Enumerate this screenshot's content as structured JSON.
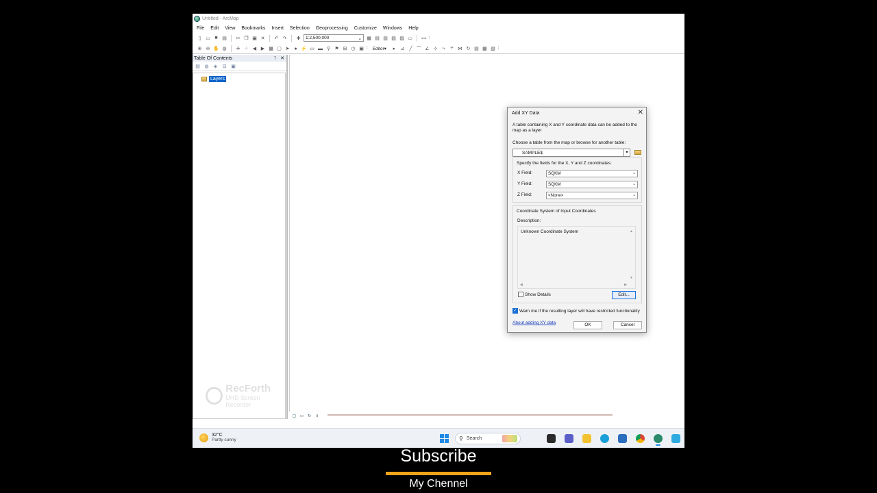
{
  "window": {
    "title": "Untitled - ArcMap"
  },
  "menu": [
    "File",
    "Edit",
    "View",
    "Bookmarks",
    "Insert",
    "Selection",
    "Geoprocessing",
    "Customize",
    "Windows",
    "Help"
  ],
  "toolbar": {
    "scale": "1:2,500,000",
    "editor_label": "Editor"
  },
  "toc": {
    "title": "Table Of Contents",
    "layers_label": "Layers"
  },
  "watermark": {
    "title": "RecForth",
    "subtitle": "UHD Screen Recorder"
  },
  "dialog": {
    "title": "Add XY Data",
    "description": "A table containing X and Y coordinate data can be added to the map as a layer",
    "choose_label": "Choose a table from the map or browse for another table:",
    "table_value": "SAMPLE$",
    "fields_legend": "Specify the fields for the X, Y and Z coordinates:",
    "fields": [
      {
        "label": "X Field:",
        "value": "SQKM"
      },
      {
        "label": "Y Field:",
        "value": "SQKM"
      },
      {
        "label": "Z Field:",
        "value": "<None>"
      }
    ],
    "coord_legend": "Coordinate System of Input Coordinates",
    "description_label": "Description:",
    "coord_description": "Unknown Coordinate System",
    "show_details": "Show Details",
    "show_details_checked": false,
    "edit_label": "Edit...",
    "warn_label": "Warn me if the resulting layer will have restricted functionality",
    "warn_checked": true,
    "about_link": "About adding XY data",
    "ok_label": "OK",
    "cancel_label": "Cancel"
  },
  "taskbar": {
    "temperature": "32°C",
    "condition": "Partly sunny",
    "search_placeholder": "Search"
  },
  "overlay": {
    "subscribe": "Subscribe",
    "channel": "My Chennel",
    "bar_color": "#f4a21a"
  }
}
